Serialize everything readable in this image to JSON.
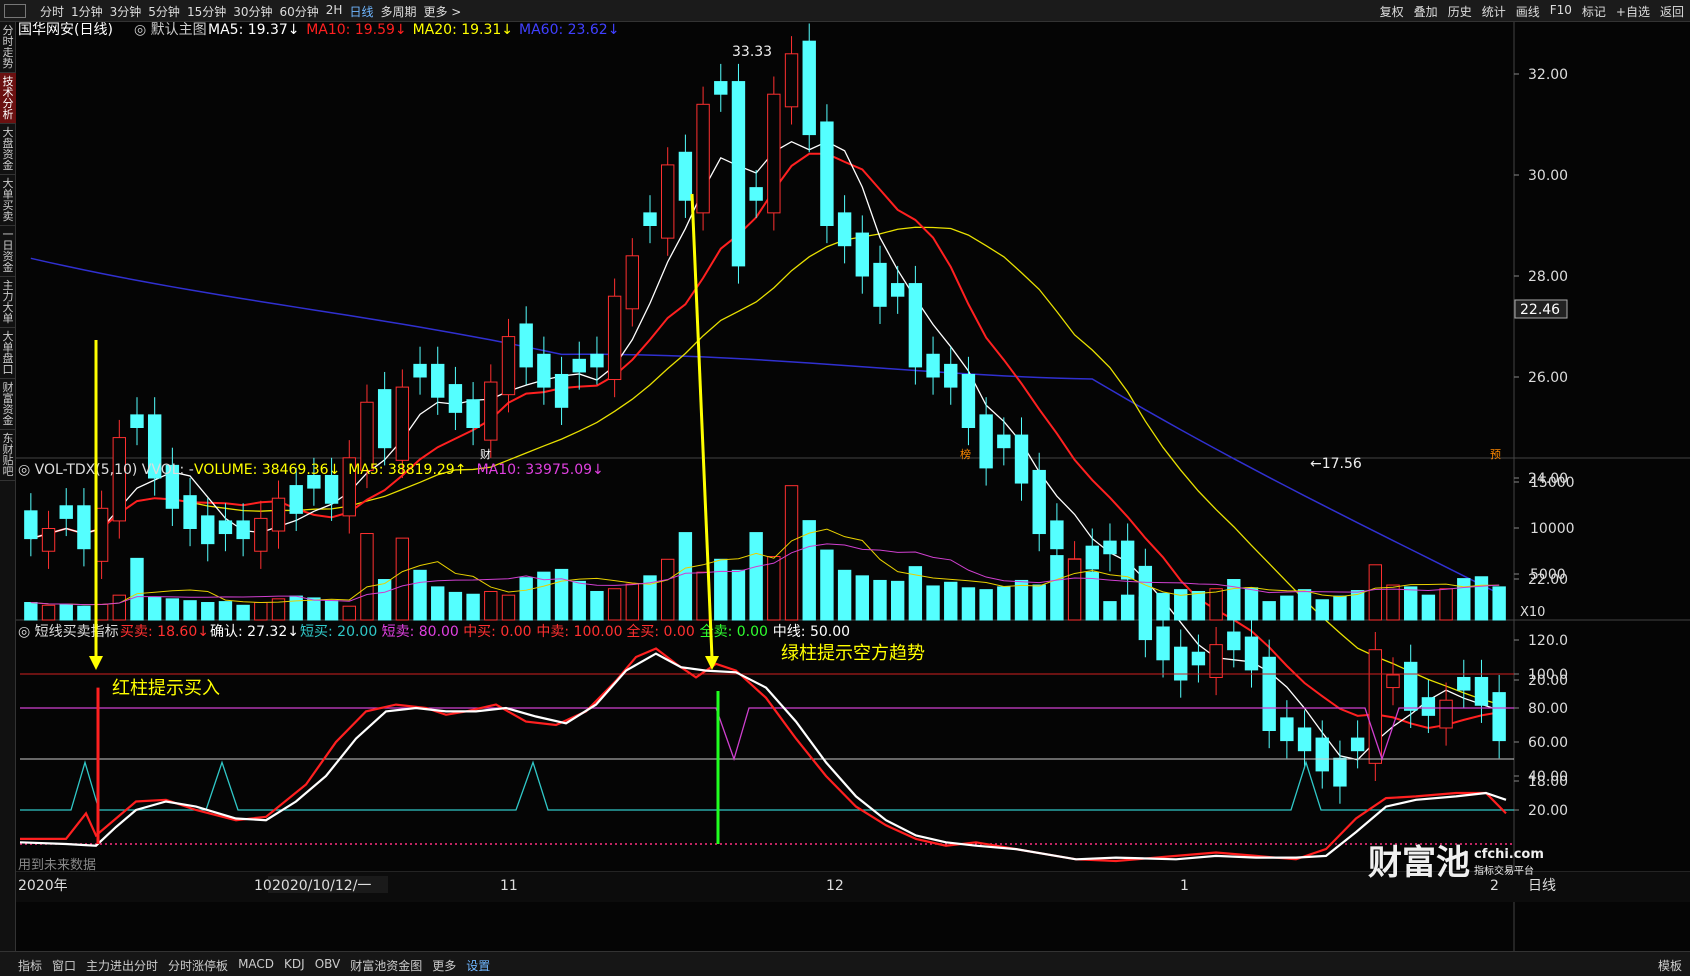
{
  "topbar": {
    "items": [
      "分时",
      "1分钟",
      "3分钟",
      "5分钟",
      "15分钟",
      "30分钟",
      "60分钟",
      "2H",
      "日线",
      "多周期",
      "更多 >"
    ],
    "active_index": 8,
    "right_items": [
      "复权",
      "叠加",
      "历史",
      "统计",
      "画线",
      "F10",
      "标记",
      "+自选",
      "返回"
    ]
  },
  "sidebar": {
    "items": [
      "分时走势",
      "技术分析",
      "大盘资金",
      "大单买卖",
      "一日资金",
      "主力大单",
      "大单盘口",
      "财富资金",
      "东财贴吧"
    ],
    "active_index": 1
  },
  "main_panel": {
    "title": "国华网安(日线)",
    "template": "默认主图",
    "ma": [
      {
        "label": "MA5: 19.37↓",
        "color": "#ffffff"
      },
      {
        "label": "MA10: 19.59↓",
        "color": "#ff2020"
      },
      {
        "label": "MA20: 19.31↓",
        "color": "#ffff00"
      },
      {
        "label": "MA60: 23.62↓",
        "color": "#4040ff"
      }
    ],
    "y_ticks": [
      "32.00",
      "30.00",
      "28.00",
      "26.00",
      "24.00",
      "22.00",
      "20.00",
      "18.00"
    ],
    "high_label": "33.33",
    "low_label": "←17.56",
    "current_price": "22.46",
    "event_markers": [
      "财",
      "榜",
      "预"
    ]
  },
  "volume_panel": {
    "title": "VOL-TDX(5,10) VVOL: -",
    "values": [
      {
        "label": "VOLUME: 38469.36↓",
        "color": "#ffff00"
      },
      {
        "label": "MA5: 38819.29↑",
        "color": "#ffff00"
      },
      {
        "label": "MA10: 33975.09↓",
        "color": "#e040e0"
      }
    ],
    "y_ticks": [
      "15000",
      "10000",
      "5000"
    ],
    "unit": "X10"
  },
  "indicator_panel": {
    "title": "短线买卖指标",
    "values": [
      {
        "label": "买卖: 18.60↓",
        "color": "#ff3030"
      },
      {
        "label": "确认: 27.32↓",
        "color": "#ffffff"
      },
      {
        "label": "短买: 20.00",
        "color": "#30c8c8"
      },
      {
        "label": "短卖: 80.00",
        "color": "#e040e0"
      },
      {
        "label": "中买: 0.00",
        "color": "#ff3030"
      },
      {
        "label": "中卖: 100.00",
        "color": "#ff3030"
      },
      {
        "label": "全买: 0.00",
        "color": "#ff3030"
      },
      {
        "label": "全卖: 0.00",
        "color": "#30ff30"
      },
      {
        "label": "中线: 50.00",
        "color": "#ffffff"
      }
    ],
    "y_ticks": [
      "120.0",
      "100.0",
      "80.00",
      "60.00",
      "40.00",
      "20.00"
    ],
    "future_data_note": "用到未来数据"
  },
  "annotations": {
    "buy": "红柱提示买入",
    "bear": "绿柱提示空方趋势"
  },
  "xaxis": {
    "year_label": "2020年",
    "date_cursor": "2020/10/12/一",
    "month_labels": [
      "10",
      "11",
      "12",
      "1",
      "2"
    ]
  },
  "watermark": {
    "brand": "财富池",
    "domain": "cfchi.com",
    "tagline": "指标交易平台"
  },
  "bottombar": {
    "items": [
      "指标",
      "窗口",
      "主力进出分时",
      "分时涨停板",
      "MACD",
      "KDJ",
      "OBV",
      "财富池资金图",
      "更多",
      "设置"
    ],
    "active_index": 9,
    "right_label": "模板"
  },
  "right_corner": {
    "period": "日线"
  },
  "colors": {
    "up": "#ff3030",
    "down": "#54ffff",
    "ma5": "#ffffff",
    "ma10": "#ff2020",
    "ma20": "#e8e000",
    "ma60": "#3030d0",
    "annotation": "#ffff00",
    "vol_ma5": "#e8d000",
    "vol_ma10": "#d040d0"
  }
}
